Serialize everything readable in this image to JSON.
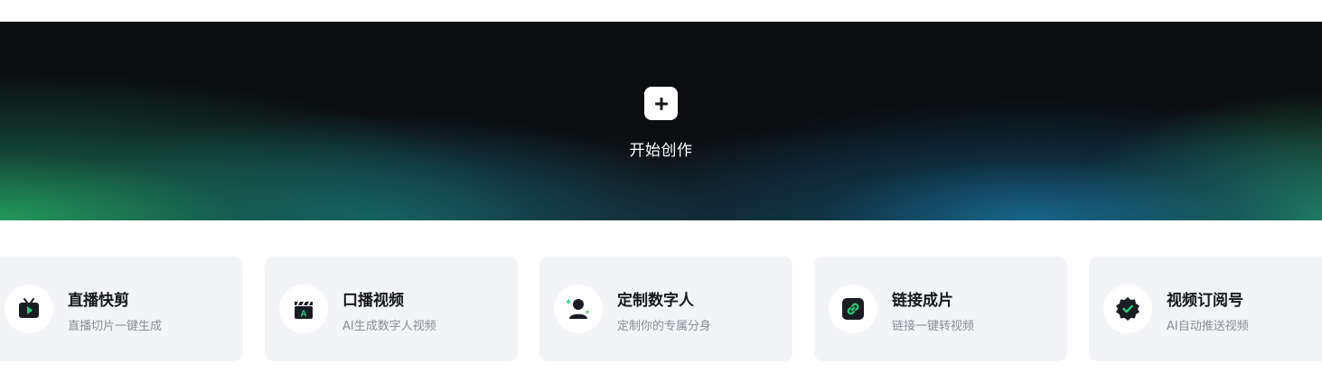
{
  "hero": {
    "label": "开始创作",
    "icon": "plus-icon"
  },
  "colors": {
    "accent_green": "#1fd87a",
    "dark_icon": "#1a1d24",
    "card_bg": "#f3f4f7"
  },
  "cards": [
    {
      "title": "直播快剪",
      "subtitle": "直播切片一键生成",
      "icon": "tv-play-icon"
    },
    {
      "title": "口播视频",
      "subtitle": "AI生成数字人视频",
      "icon": "clapperboard-icon"
    },
    {
      "title": "定制数字人",
      "subtitle": "定制你的专属分身",
      "icon": "person-sparkle-icon"
    },
    {
      "title": "链接成片",
      "subtitle": "链接一键转视频",
      "icon": "link-icon"
    },
    {
      "title": "视频订阅号",
      "subtitle": "AI自动推送视频",
      "icon": "verified-badge-icon"
    }
  ]
}
